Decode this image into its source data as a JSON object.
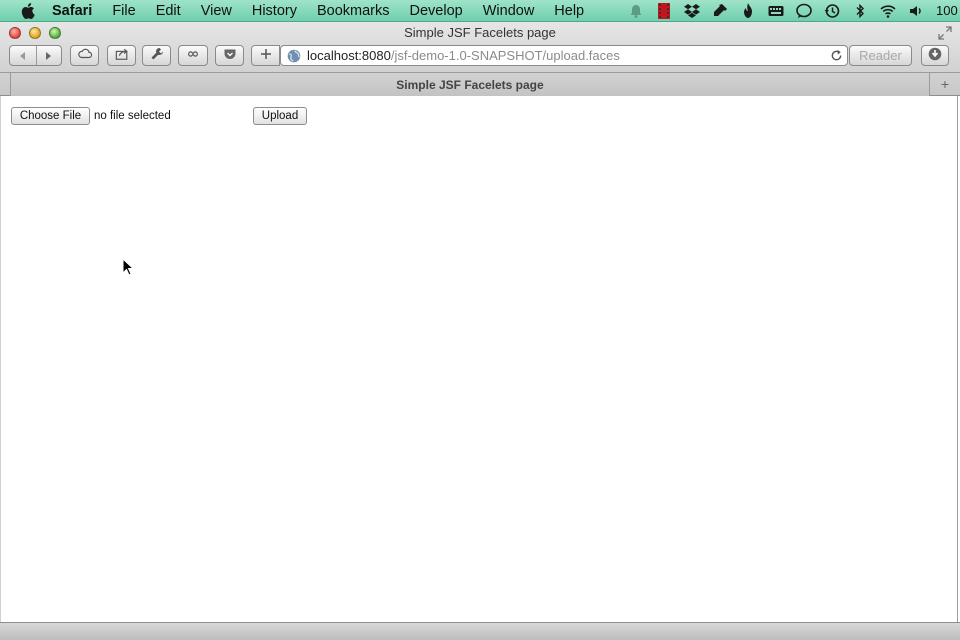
{
  "menubar": {
    "app_name": "Safari",
    "items": [
      "File",
      "Edit",
      "View",
      "History",
      "Bookmarks",
      "Develop",
      "Window",
      "Help"
    ],
    "status_icons": [
      "notification-bell-icon",
      "video-app-icon",
      "dropbox-icon",
      "pen-tool-icon",
      "flame-icon",
      "keyboard-icon",
      "chat-bubble-icon",
      "time-machine-icon",
      "bluetooth-icon",
      "wifi-icon",
      "volume-icon"
    ],
    "battery_text": "100"
  },
  "window": {
    "title": "Simple JSF Facelets page"
  },
  "toolbar": {
    "url_host": "localhost:8080",
    "url_path": "/jsf-demo-1.0-SNAPSHOT/upload.faces",
    "reader_label": "Reader"
  },
  "tab": {
    "label": "Simple JSF Facelets page"
  },
  "page": {
    "choose_file_label": "Choose File",
    "file_status": "no file selected",
    "upload_label": "Upload"
  },
  "colors": {
    "menubar": "#7fd8b8",
    "chrome": "#d6d6d6"
  }
}
